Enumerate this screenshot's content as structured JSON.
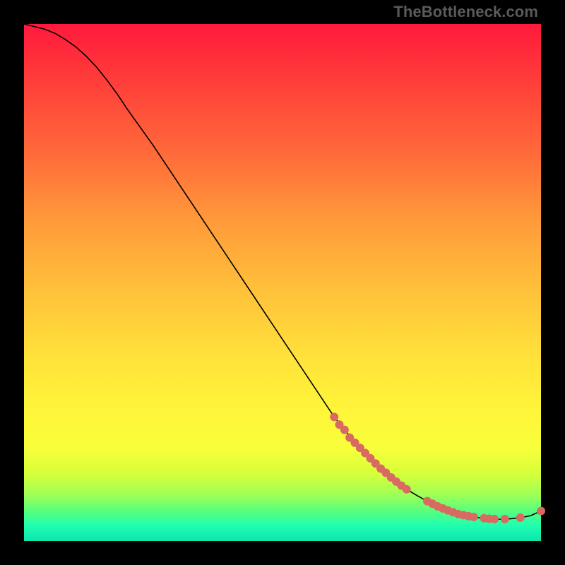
{
  "watermark": "TheBottleneck.com",
  "colors": {
    "curve_stroke": "#000000",
    "marker_fill": "#d96a62",
    "marker_stroke": "#b34c44",
    "background": "#000000"
  },
  "chart_data": {
    "type": "line",
    "title": "",
    "xlabel": "",
    "ylabel": "",
    "xlim": [
      0,
      100
    ],
    "ylim": [
      0,
      100
    ],
    "grid": false,
    "legend": false,
    "x": [
      0,
      2,
      4,
      6,
      8,
      10,
      12,
      14,
      16,
      18,
      20,
      25,
      30,
      35,
      40,
      45,
      50,
      55,
      60,
      62,
      65,
      68,
      70,
      72,
      74,
      76,
      78,
      80,
      82,
      84,
      86,
      88,
      90,
      92,
      94,
      96,
      98,
      100
    ],
    "values": [
      100,
      99.5,
      99,
      98.2,
      97,
      95.6,
      93.8,
      91.7,
      89.2,
      86.5,
      83.5,
      76.5,
      69,
      61.5,
      54,
      46.5,
      39,
      31.5,
      24,
      21.5,
      18,
      15,
      13.2,
      11.5,
      10,
      8.8,
      7.7,
      6.7,
      5.9,
      5.2,
      4.8,
      4.5,
      4.3,
      4.2,
      4.3,
      4.5,
      4.9,
      5.8
    ],
    "markers": [
      {
        "x": 60,
        "y": 24
      },
      {
        "x": 61,
        "y": 22.5
      },
      {
        "x": 62,
        "y": 21.5
      },
      {
        "x": 63,
        "y": 20
      },
      {
        "x": 64,
        "y": 19
      },
      {
        "x": 65,
        "y": 18
      },
      {
        "x": 66,
        "y": 17
      },
      {
        "x": 67,
        "y": 16
      },
      {
        "x": 68,
        "y": 15
      },
      {
        "x": 69,
        "y": 14
      },
      {
        "x": 70,
        "y": 13.2
      },
      {
        "x": 71,
        "y": 12.3
      },
      {
        "x": 72,
        "y": 11.5
      },
      {
        "x": 73,
        "y": 10.7
      },
      {
        "x": 74,
        "y": 10
      },
      {
        "x": 78,
        "y": 7.7
      },
      {
        "x": 79,
        "y": 7.2
      },
      {
        "x": 80,
        "y": 6.7
      },
      {
        "x": 81,
        "y": 6.3
      },
      {
        "x": 82,
        "y": 5.9
      },
      {
        "x": 83,
        "y": 5.55
      },
      {
        "x": 84,
        "y": 5.2
      },
      {
        "x": 85,
        "y": 5.0
      },
      {
        "x": 86,
        "y": 4.8
      },
      {
        "x": 87,
        "y": 4.65
      },
      {
        "x": 89,
        "y": 4.4
      },
      {
        "x": 90,
        "y": 4.3
      },
      {
        "x": 91,
        "y": 4.25
      },
      {
        "x": 93,
        "y": 4.25
      },
      {
        "x": 96,
        "y": 4.5
      },
      {
        "x": 100,
        "y": 5.8
      }
    ]
  }
}
